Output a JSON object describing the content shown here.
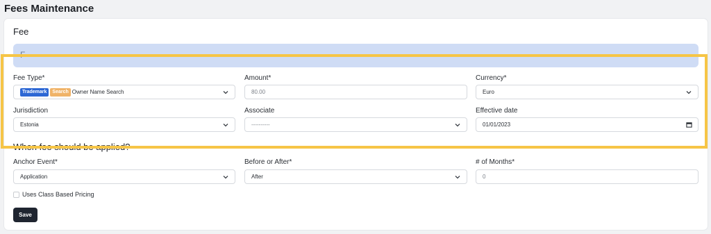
{
  "page": {
    "title": "Fees Maintenance"
  },
  "section": {
    "title": "Fee",
    "banner_text": "F"
  },
  "fields": {
    "fee_type": {
      "label": "Fee Type*",
      "badge_trademark": "Trademark",
      "badge_search": "Search",
      "value": "Owner Name Search"
    },
    "amount": {
      "label": "Amount*",
      "value": "80.00"
    },
    "currency": {
      "label": "Currency*",
      "value": "Euro"
    },
    "jurisdiction": {
      "label": "Jurisdiction",
      "value": "Estonia"
    },
    "associate": {
      "label": "Associate",
      "value": "----------"
    },
    "effective_date": {
      "label": "Effective date",
      "value": "01/01/2023"
    },
    "anchor_event": {
      "label": "Anchor Event*",
      "value": "Application"
    },
    "before_after": {
      "label": "Before or After*",
      "value": "After"
    },
    "months": {
      "label": "# of Months*",
      "value": "0"
    }
  },
  "applied_heading": "When fee should be applied?",
  "class_pricing": {
    "label": "Uses Class Based Pricing",
    "checked": false
  },
  "actions": {
    "save_label": "Save"
  },
  "colors": {
    "highlight": "#f6c546",
    "badge_trademark": "#2d67d4",
    "badge_search": "#f0b368",
    "button": "#1f2530",
    "banner": "#cfdcf5"
  },
  "icons": {
    "select": "chevron-down-icon",
    "date": "calendar-icon"
  }
}
